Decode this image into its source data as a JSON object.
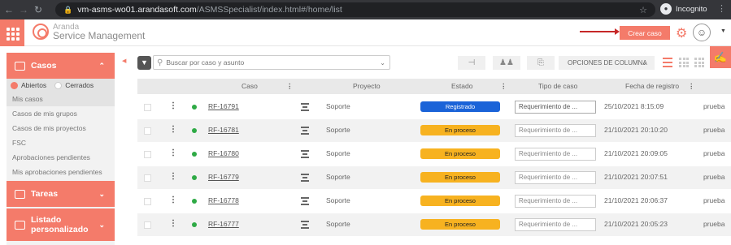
{
  "browser": {
    "url_host": "vm-asms-wo01.arandasoft.com",
    "url_path": "/ASMSSpecialist/index.html#/home/list",
    "profile": "Incognito"
  },
  "app": {
    "brand": "Aranda",
    "product": "Service Management",
    "create_button": "Crear caso"
  },
  "sidebar": {
    "casos_label": "Casos",
    "toggle_open": "Abiertos",
    "toggle_closed": "Cerrados",
    "items": [
      "Mis casos",
      "Casos de mis grupos",
      "Casos de mis proyectos",
      "FSC",
      "Aprobaciones pendientes",
      "Mis aprobaciones pendientes"
    ],
    "tareas_label": "Tareas",
    "listado_label_1": "Listado",
    "listado_label_2": "personalizado"
  },
  "toolbar": {
    "search_placeholder": "Buscar por caso y asunto",
    "column_options": "OPCIONES DE COLUMNA"
  },
  "table": {
    "headers": [
      "Caso",
      "Proyecto",
      "Estado",
      "Tipo de caso",
      "Fecha de registro"
    ],
    "rows": [
      {
        "case": "RF-16791",
        "project": "Soporte",
        "status": "Registrado",
        "type": "Requerimiento de ...",
        "date": "25/10/2021 8:15:09",
        "user": "prueba"
      },
      {
        "case": "RF-16781",
        "project": "Soporte",
        "status": "En proceso",
        "type": "Requerimiento de ...",
        "date": "21/10/2021 20:10:20",
        "user": "prueba"
      },
      {
        "case": "RF-16780",
        "project": "Soporte",
        "status": "En proceso",
        "type": "Requerimiento de ...",
        "date": "21/10/2021 20:09:05",
        "user": "prueba"
      },
      {
        "case": "RF-16779",
        "project": "Soporte",
        "status": "En proceso",
        "type": "Requerimiento de ...",
        "date": "21/10/2021 20:07:51",
        "user": "prueba"
      },
      {
        "case": "RF-16778",
        "project": "Soporte",
        "status": "En proceso",
        "type": "Requerimiento de ...",
        "date": "21/10/2021 20:06:37",
        "user": "prueba"
      },
      {
        "case": "RF-16777",
        "project": "Soporte",
        "status": "En proceso",
        "type": "Requerimiento de ...",
        "date": "21/10/2021 20:05:23",
        "user": "prueba"
      }
    ]
  },
  "colors": {
    "accent": "#f47b6a",
    "status_registered": "#1a63d8",
    "status_in_process": "#f7b220",
    "active_dot": "#2eaa45"
  }
}
